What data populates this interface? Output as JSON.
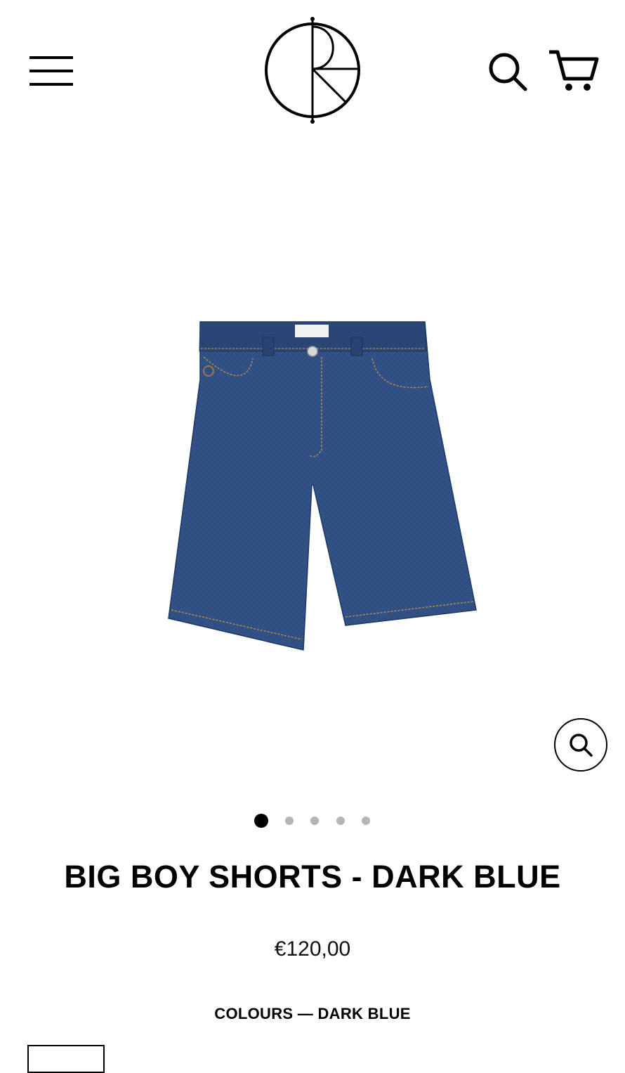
{
  "header": {
    "menu_icon": "hamburger-menu-icon",
    "logo_icon": "brand-logo-icon",
    "search_icon": "search-icon",
    "cart_icon": "cart-icon"
  },
  "product": {
    "image_icon": "denim-shorts-image",
    "denim_color": "#2c4b7f",
    "title": "BIG BOY SHORTS - DARK BLUE",
    "price": "€120,00",
    "colours_label": "COLOURS — DARK BLUE"
  },
  "gallery": {
    "zoom_icon": "zoom-icon",
    "slide_count": 5,
    "active_index": 0
  }
}
